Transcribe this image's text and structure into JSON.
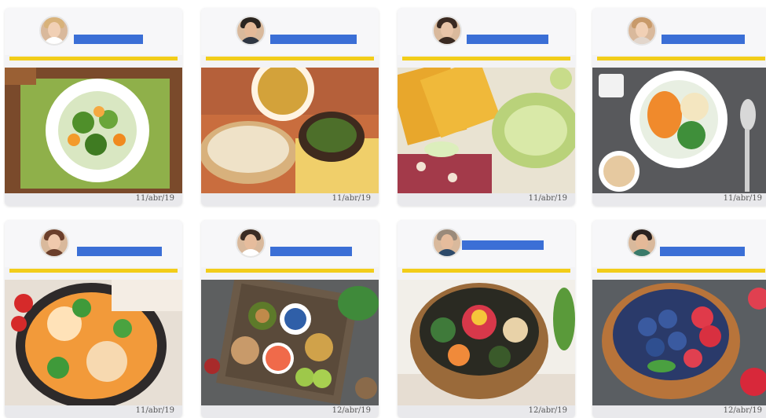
{
  "cards": [
    {
      "date": "11/abr/19",
      "avatar_icon": "woman-avatar-icon",
      "photo": "salad-plate-image"
    },
    {
      "date": "11/abr/19",
      "avatar_icon": "man-avatar-icon",
      "photo": "tortillas-stew-image"
    },
    {
      "date": "11/abr/19",
      "avatar_icon": "woman-avatar-icon",
      "photo": "corn-avocado-image"
    },
    {
      "date": "11/abr/19",
      "avatar_icon": "woman-avatar-icon",
      "photo": "veggie-bowl-image"
    },
    {
      "date": "11/abr/19",
      "avatar_icon": "woman-avatar-icon",
      "photo": "chicken-vegetables-image"
    },
    {
      "date": "12/abr/19",
      "avatar_icon": "man-avatar-icon",
      "photo": "healthy-food-box-image"
    },
    {
      "date": "12/abr/19",
      "avatar_icon": "man-avatar-icon",
      "photo": "bibimbap-bowl-image"
    },
    {
      "date": "12/abr/19",
      "avatar_icon": "man-avatar-icon",
      "photo": "berries-bowl-image"
    }
  ],
  "colors": {
    "accent_bar": "#f2cd1a",
    "redaction": "#3b6fd6"
  }
}
